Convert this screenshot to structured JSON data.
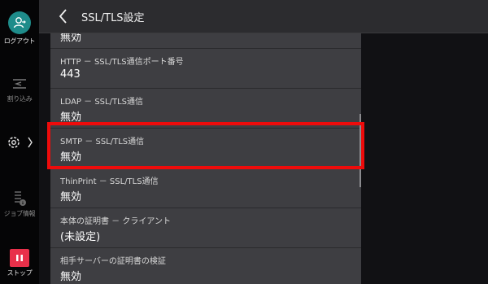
{
  "header": {
    "title": "SSL/TLS設定",
    "back_icon": "chevron-left-icon"
  },
  "sidebar": {
    "logout_label": "ログアウト",
    "interrupt_label": "割り込み",
    "job_info_label": "ジョブ情報",
    "stop_label": "ストップ",
    "colors": {
      "logout": "#1e8c8a",
      "stop": "#e8304a"
    }
  },
  "list": {
    "partial_row_value": "無効",
    "items": [
      {
        "label": "HTTP － SSL/TLS通信ポート番号",
        "value": "443"
      },
      {
        "label": "LDAP － SSL/TLS通信",
        "value": "無効"
      },
      {
        "label": "SMTP － SSL/TLS通信",
        "value": "無効",
        "highlighted": true
      },
      {
        "label": "ThinPrint － SSL/TLS通信",
        "value": "無効"
      },
      {
        "label": "本体の証明書 － クライアント",
        "value": "(未設定)"
      },
      {
        "label": "相手サーバーの証明書の検証",
        "value": "無効"
      }
    ]
  },
  "highlight_color": "#ee0b0b"
}
